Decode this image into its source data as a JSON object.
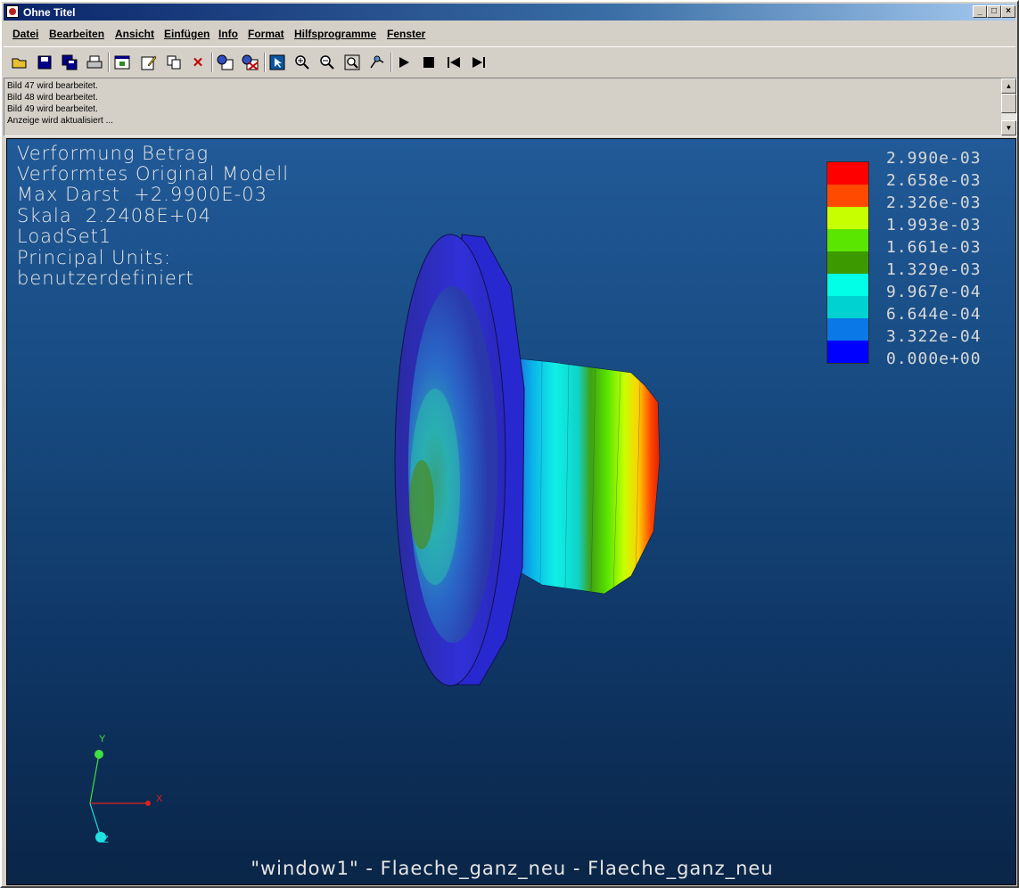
{
  "window": {
    "title": "Ohne Titel"
  },
  "menu": [
    "Datei",
    "Bearbeiten",
    "Ansicht",
    "Einfügen",
    "Info",
    "Format",
    "Hilfsprogramme",
    "Fenster"
  ],
  "toolbar_icons": [
    "open-folder-icon",
    "save-icon",
    "save-all-icon",
    "print-icon",
    "window-properties-icon",
    "edit-icon",
    "copy-icon",
    "delete-icon",
    "view-icon",
    "view-off-icon",
    "select-icon",
    "zoom-in-icon",
    "zoom-out-icon",
    "zoom-fit-icon",
    "spin-icon",
    "play-icon",
    "stop-icon",
    "first-frame-icon",
    "last-frame-icon"
  ],
  "messages": [
    "Bild 47 wird bearbeitet.",
    "Bild 48 wird bearbeitet.",
    "Bild 49 wird bearbeitet.",
    "Anzeige wird aktualisiert ..."
  ],
  "viewport": {
    "info": [
      "Verformung Betrag",
      "Verformtes Original Modell",
      "Max Darst  +2.9900E-03",
      "Skala  2.2408E+04",
      "LoadSet1",
      "Principal Units:",
      "benutzerdefiniert"
    ],
    "legend": [
      {
        "label": "2.990e-03",
        "color": "#ff0000"
      },
      {
        "label": "2.658e-03",
        "color": "#ff4a00"
      },
      {
        "label": "2.326e-03",
        "color": "#c8ff00"
      },
      {
        "label": "1.993e-03",
        "color": "#5ae600"
      },
      {
        "label": "1.661e-03",
        "color": "#3c9a00"
      },
      {
        "label": "1.329e-03",
        "color": "#00ffe6"
      },
      {
        "label": "9.967e-04",
        "color": "#00d2d2"
      },
      {
        "label": "6.644e-04",
        "color": "#0a78e6"
      },
      {
        "label": "3.322e-04",
        "color": "#0000ff"
      },
      {
        "label": "0.000e+00",
        "color": ""
      }
    ],
    "axes": {
      "x": "X",
      "y": "Y",
      "z": "Z"
    },
    "footer": "\"window1\" - Flaeche_ganz_neu - Flaeche_ganz_neu"
  }
}
